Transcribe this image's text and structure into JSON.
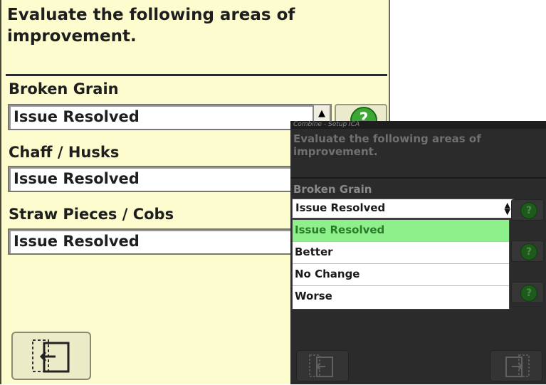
{
  "zoomed_panel": {
    "prompt": "Evaluate the following areas of improvement.",
    "fields": [
      {
        "label": "Broken Grain",
        "value": "Issue Resolved"
      },
      {
        "label": "Chaff / Husks",
        "value": "Issue Resolved"
      },
      {
        "label": "Straw Pieces / Cobs",
        "value": "Issue Resolved"
      }
    ],
    "help_glyph": "?",
    "back_icon": "back-page-icon"
  },
  "dark_panel": {
    "window_title": "Combine - Setup ICA",
    "prompt": "Evaluate the following areas of improvement.",
    "field_label": "Broken Grain",
    "selected_value": "Issue Resolved",
    "options": [
      "Issue Resolved",
      "Better",
      "No Change",
      "Worse"
    ],
    "help_glyph": "?",
    "back_icon": "back-page-icon",
    "forward_icon": "next-page-icon"
  },
  "colors": {
    "panel_bg": "#fdfccf",
    "dark_bg": "#2b2b2b",
    "selected_option": "#8ef08a",
    "help_green": "#3aa832"
  }
}
